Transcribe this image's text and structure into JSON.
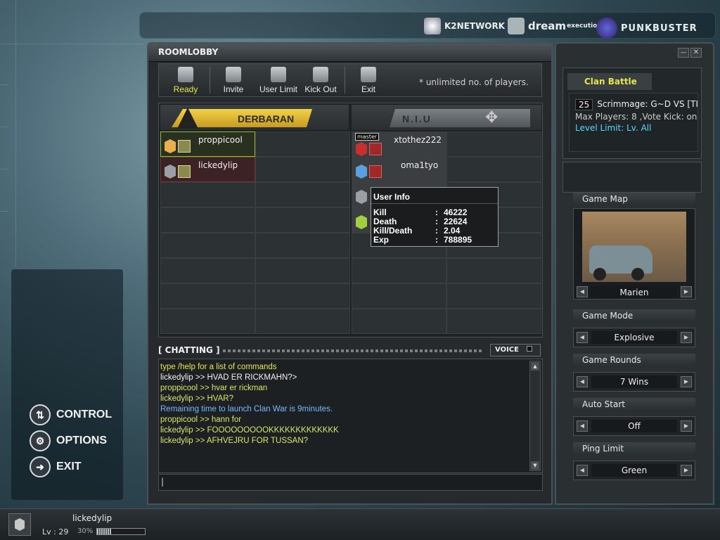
{
  "brands": [
    "K2NETWORK",
    "dream",
    "execution",
    "PUNKBUSTER"
  ],
  "menu": {
    "control": "CONTROL",
    "options": "OPTIONS",
    "exit": "EXIT"
  },
  "lobby": {
    "title": "ROOMLOBBY",
    "toolbar": {
      "ready": "Ready",
      "invite": "Invite",
      "user_limit": "User Limit",
      "kick_out": "Kick Out",
      "exit": "Exit"
    },
    "note": "* unlimited no. of players.",
    "team_a": "DERBARAN",
    "team_b": "N.I.U"
  },
  "players_a": [
    {
      "name": "proppicool"
    },
    {
      "name": "lickedylip"
    }
  ],
  "players_b": [
    {
      "name": "xtothez222",
      "badge": "master"
    },
    {
      "name": "oma1tyo"
    }
  ],
  "user_info": {
    "title": "User Info",
    "rows": [
      {
        "label": "Kill",
        "value": "46222"
      },
      {
        "label": "Death",
        "value": "22624"
      },
      {
        "label": "Kill/Death",
        "value": "2.04"
      },
      {
        "label": "Exp",
        "value": "788895"
      }
    ]
  },
  "chat": {
    "title": "CHATTING",
    "voice": "VOICE",
    "lines": [
      {
        "text": "type /help for a list of commands",
        "color": "#e6e64a"
      },
      {
        "text": "lickedylip >> HVAD ER RICKMAHN?>",
        "color": "#f0f0f0"
      },
      {
        "text": "proppicool >> hvar er rickman",
        "color": "#d4e86a"
      },
      {
        "text": "lickedylip >> HVAR?",
        "color": "#d4e86a"
      },
      {
        "text": "Remaining time to launch Clan War is 9minutes.",
        "color": "#78b8ff"
      },
      {
        "text": "proppicool >> hann for",
        "color": "#d4e86a"
      },
      {
        "text": "lickedylip >> FOOOOOOOOOKKKKKKKKKKKKK",
        "color": "#d4e86a"
      },
      {
        "text": "lickedylip >> AFHVEJRU FOR TUSSAN?",
        "color": "#d4e86a"
      }
    ]
  },
  "room": {
    "tab": "Clan Battle",
    "number": "25",
    "name": "Scrimmage: G~D VS [TI",
    "info": "Max Players: 8 ,Vote Kick: on",
    "level_limit": "Level Limit: Lv. All"
  },
  "settings": {
    "game_map_label": "Game Map",
    "game_map": "Marien",
    "game_mode_label": "Game Mode",
    "game_mode": "Explosive",
    "game_rounds_label": "Game Rounds",
    "game_rounds": "7 Wins",
    "auto_start_label": "Auto Start",
    "auto_start": "Off",
    "ping_limit_label": "Ping Limit",
    "ping_limit": "Green"
  },
  "status": {
    "name": "lickedylip",
    "level_label": "Lv : 29",
    "exp_pct": "30%",
    "exp_fraction": 0.3
  },
  "colors": {
    "accent_yellow": "#e6c23a",
    "level_cyan": "#58d8ff",
    "chat_default": "#d4e86a"
  }
}
